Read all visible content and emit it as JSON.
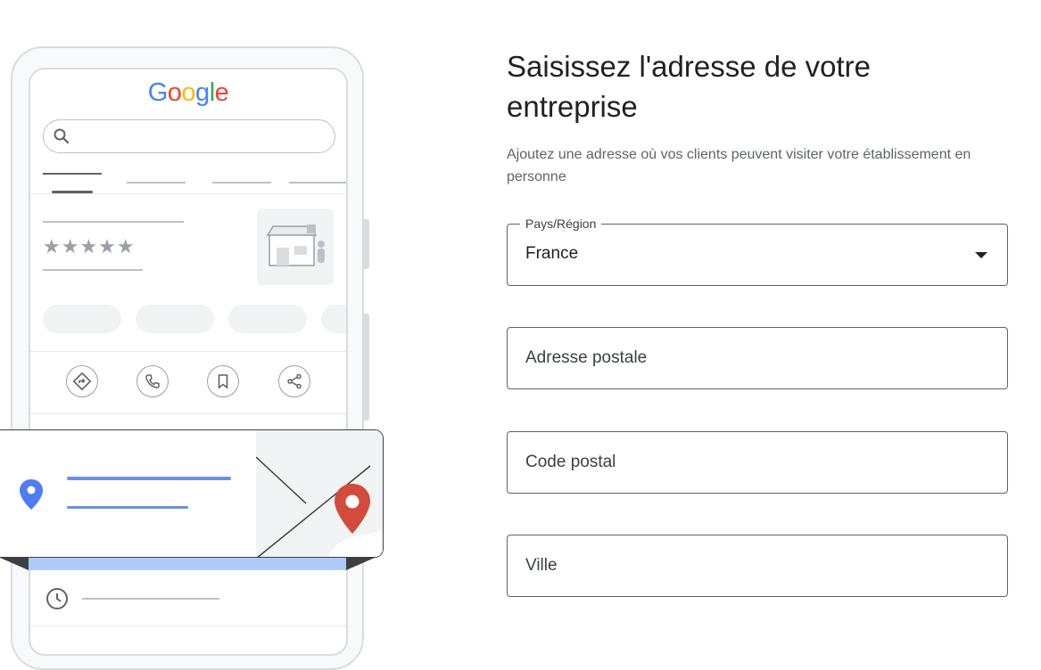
{
  "illustration": {
    "logo_letters": [
      {
        "char": "G",
        "color": "#4285f4"
      },
      {
        "char": "o",
        "color": "#ea4335"
      },
      {
        "char": "o",
        "color": "#fbbc05"
      },
      {
        "char": "g",
        "color": "#4285f4"
      },
      {
        "char": "l",
        "color": "#34a853"
      },
      {
        "char": "e",
        "color": "#ea4335"
      }
    ],
    "rating_stars": "★★★★★",
    "icons": [
      "search-icon",
      "store-icon",
      "directions-icon",
      "phone-icon",
      "bookmark-icon",
      "share-icon",
      "location-pin-icon",
      "map-pin-icon",
      "clock-icon"
    ],
    "colors": {
      "pin_blue": "#4f7cf0",
      "map_pin_red": "#d24b3c",
      "accent_line": "#6b8fe8",
      "accent_bar": "#aecbfa"
    }
  },
  "form": {
    "title": "Saisissez l'adresse de votre entreprise",
    "subtitle": "Ajoutez une adresse où vos clients peuvent visiter votre établissement en personne",
    "country": {
      "label": "Pays/Région",
      "value": "France"
    },
    "street": {
      "placeholder": "Adresse postale"
    },
    "postal_code": {
      "placeholder": "Code postal"
    },
    "city": {
      "placeholder": "Ville"
    }
  }
}
